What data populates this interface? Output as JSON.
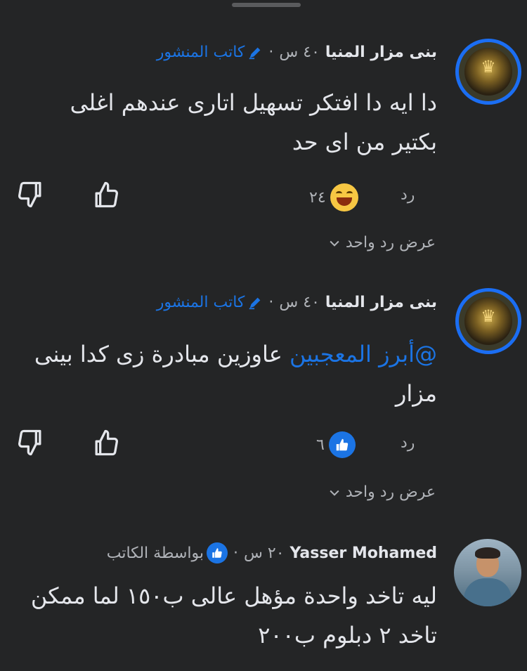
{
  "comments": [
    {
      "name": "بنى مزار المنيا",
      "time": "٤٠ س",
      "badge": "كاتب المنشور",
      "text": "دا ايه دا افتكر تسهيل اتارى عندهم اغلى بكتير من اى حد",
      "reply": "رد",
      "reaction_count": "٢٤",
      "reaction_type": "haha",
      "view_replies": "عرض رد واحد"
    },
    {
      "name": "بنى مزار المنيا",
      "time": "٤٠ س",
      "badge": "كاتب المنشور",
      "mention": "@أبرز المعجبين",
      "text": " عاوزين مبادرة زى كدا بينى مزار",
      "reply": "رد",
      "reaction_count": "٦",
      "reaction_type": "like",
      "view_replies": "عرض رد واحد"
    },
    {
      "name": "Yasser Mohamed",
      "time": "٢٠ س",
      "badge": "بواسطة الكاتب",
      "text": "ليه تاخد واحدة مؤهل عالى ب١٥٠ لما ممكن تاخد ٢ دبلوم ب٢٠٠"
    }
  ],
  "colors": {
    "background": "#242526",
    "accent": "#1b74e4",
    "avatar_ring": "#1b6ef3"
  },
  "icons": [
    "pencil-icon",
    "thumbs-down-icon",
    "thumbs-up-icon",
    "haha-emoji-icon",
    "like-reaction-icon",
    "chevron-down-icon"
  ]
}
